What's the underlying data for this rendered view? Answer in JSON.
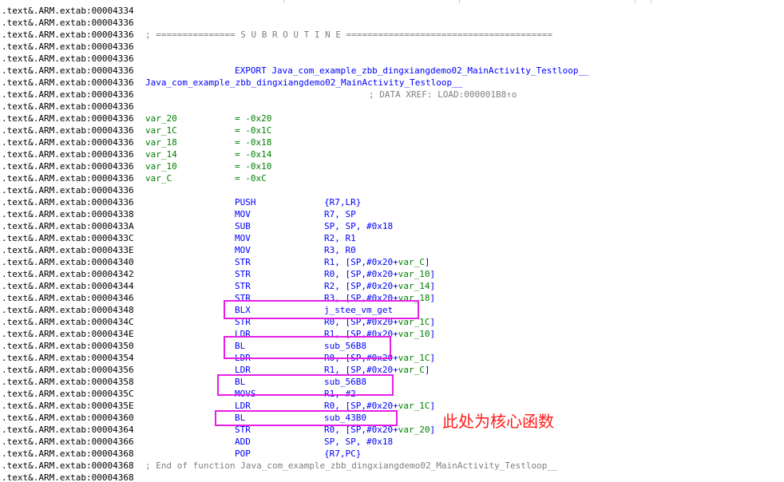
{
  "listing": {
    "lines": [
      {
        "addr": ".text&.ARM.extab:00004334"
      },
      {
        "addr": ".text&.ARM.extab:00004336"
      },
      {
        "addr": ".text&.ARM.extab:00004336",
        "comment": "; =============== S U B R O U T I N E ======================================="
      },
      {
        "addr": ".text&.ARM.extab:00004336"
      },
      {
        "addr": ".text&.ARM.extab:00004336"
      },
      {
        "addr": ".text&.ARM.extab:00004336",
        "export": "EXPORT Java_com_example_zbb_dingxiangdemo02_MainActivity_Testloop__"
      },
      {
        "addr": ".text&.ARM.extab:00004336",
        "label": "Java_com_example_zbb_dingxiangdemo02_MainActivity_Testloop__"
      },
      {
        "addr": ".text&.ARM.extab:00004336",
        "xref": "; DATA XREF: LOAD:000001B8↑o"
      },
      {
        "addr": ".text&.ARM.extab:00004336"
      },
      {
        "addr": ".text&.ARM.extab:00004336",
        "var": "var_20",
        "val": "= -0x20"
      },
      {
        "addr": ".text&.ARM.extab:00004336",
        "var": "var_1C",
        "val": "= -0x1C"
      },
      {
        "addr": ".text&.ARM.extab:00004336",
        "var": "var_18",
        "val": "= -0x18"
      },
      {
        "addr": ".text&.ARM.extab:00004336",
        "var": "var_14",
        "val": "= -0x14"
      },
      {
        "addr": ".text&.ARM.extab:00004336",
        "var": "var_10",
        "val": "= -0x10"
      },
      {
        "addr": ".text&.ARM.extab:00004336",
        "var": "var_C",
        "val": "= -0xC"
      },
      {
        "addr": ".text&.ARM.extab:00004336"
      },
      {
        "addr": ".text&.ARM.extab:00004336",
        "mn": "PUSH",
        "op": "{R7,LR}"
      },
      {
        "addr": ".text&.ARM.extab:00004338",
        "mn": "MOV",
        "op": "R7, SP"
      },
      {
        "addr": ".text&.ARM.extab:0000433A",
        "mn": "SUB",
        "op": "SP, SP, #0x18"
      },
      {
        "addr": ".text&.ARM.extab:0000433C",
        "mn": "MOV",
        "op": "R2, R1"
      },
      {
        "addr": ".text&.ARM.extab:0000433E",
        "mn": "MOV",
        "op": "R3, R0"
      },
      {
        "addr": ".text&.ARM.extab:00004340",
        "mn": "STR",
        "op": "R1, [SP,#0x20+var_C]"
      },
      {
        "addr": ".text&.ARM.extab:00004342",
        "mn": "STR",
        "op": "R0, [SP,#0x20+var_10]"
      },
      {
        "addr": ".text&.ARM.extab:00004344",
        "mn": "STR",
        "op": "R2, [SP,#0x20+var_14]"
      },
      {
        "addr": ".text&.ARM.extab:00004346",
        "mn": "STR",
        "op": "R3, [SP,#0x20+var_18]"
      },
      {
        "addr": ".text&.ARM.extab:00004348",
        "mn": "BLX",
        "op": "j_stee_vm_get"
      },
      {
        "addr": ".text&.ARM.extab:0000434C",
        "mn": "STR",
        "op": "R0, [SP,#0x20+var_1C]"
      },
      {
        "addr": ".text&.ARM.extab:0000434E",
        "mn": "LDR",
        "op": "R1, [SP,#0x20+var_10]"
      },
      {
        "addr": ".text&.ARM.extab:00004350",
        "mn": "BL",
        "op": "sub_56B8"
      },
      {
        "addr": ".text&.ARM.extab:00004354",
        "mn": "LDR",
        "op": "R0, [SP,#0x20+var_1C]"
      },
      {
        "addr": ".text&.ARM.extab:00004356",
        "mn": "LDR",
        "op": "R1, [SP,#0x20+var_C]"
      },
      {
        "addr": ".text&.ARM.extab:00004358",
        "mn": "BL",
        "op": "sub_56B8"
      },
      {
        "addr": ".text&.ARM.extab:0000435C",
        "mn": "MOVS",
        "op": "R1, #2"
      },
      {
        "addr": ".text&.ARM.extab:0000435E",
        "mn": "LDR",
        "op": "R0, [SP,#0x20+var_1C]"
      },
      {
        "addr": ".text&.ARM.extab:00004360",
        "mn": "BL",
        "op": "sub_43B0"
      },
      {
        "addr": ".text&.ARM.extab:00004364",
        "mn": "STR",
        "op": "R0, [SP,#0x20+var_20]"
      },
      {
        "addr": ".text&.ARM.extab:00004366",
        "mn": "ADD",
        "op": "SP, SP, #0x18"
      },
      {
        "addr": ".text&.ARM.extab:00004368",
        "mn": "POP",
        "op": "{R7,PC}"
      },
      {
        "addr": ".text&.ARM.extab:00004368",
        "endcomment": "; End of function Java_com_example_zbb_dingxiangdemo02_MainActivity_Testloop__"
      },
      {
        "addr": ".text&.ARM.extab:00004368"
      }
    ]
  },
  "annotation": {
    "text": "此处为核心函数",
    "color": "#ff1a1a"
  },
  "colors": {
    "highlight_box": "#e81ee8",
    "instruction": "#0000ff",
    "variable": "#008000",
    "comment": "#7f7f7f"
  }
}
